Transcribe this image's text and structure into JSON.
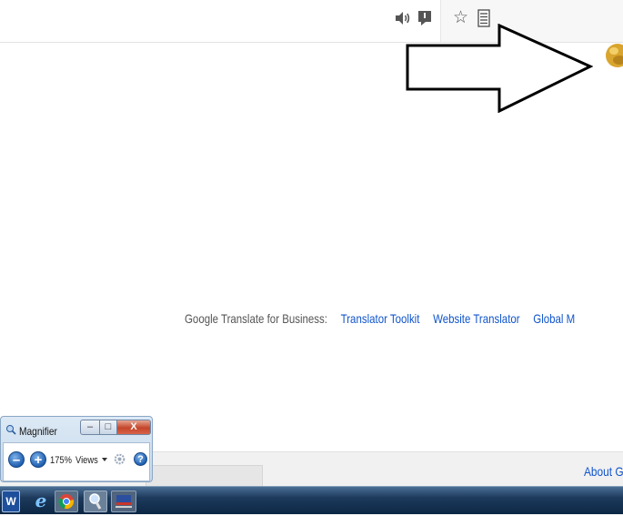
{
  "toolbar": {
    "icons": [
      "speaker-icon",
      "comment-icon",
      "star-icon",
      "document-icon"
    ],
    "star_glyph": "☆"
  },
  "annotation": {
    "arrow": "right-arrow",
    "avatar": "user-avatar"
  },
  "business": {
    "label": "Google Translate for Business:",
    "links": [
      "Translator Toolkit",
      "Website Translator",
      "Global M"
    ]
  },
  "footer": {
    "about": "About G"
  },
  "magnifier": {
    "title": "Magnifier",
    "minimize": "–",
    "maximize": "□",
    "close": "X",
    "zoom_out": "–",
    "zoom_in": "+",
    "zoom_level": "175%",
    "views": "Views",
    "help": "?"
  },
  "taskbar": {
    "items": [
      "word",
      "internet-explorer",
      "chrome",
      "magnifier",
      "flag"
    ],
    "word_label": "W",
    "ie_label": "e"
  },
  "colors": {
    "link": "#1155cc",
    "taskbar": "#1d3a5c",
    "close": "#c4462a"
  }
}
